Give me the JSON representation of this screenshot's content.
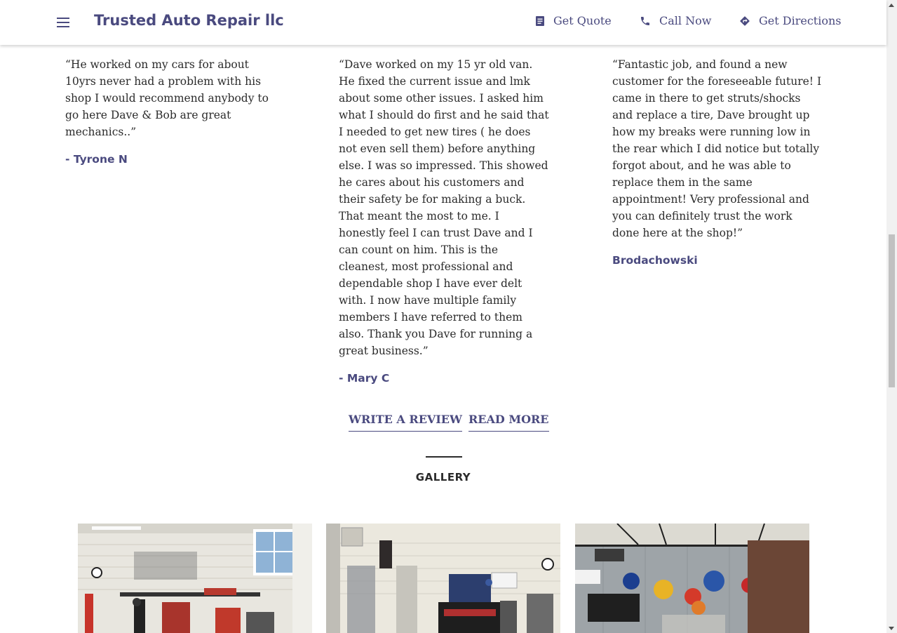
{
  "header": {
    "brand": "Trusted Auto Repair llc",
    "actions": [
      {
        "label": "Get Quote",
        "icon": "document-icon"
      },
      {
        "label": "Call Now",
        "icon": "phone-icon"
      },
      {
        "label": "Get Directions",
        "icon": "directions-icon"
      }
    ]
  },
  "reviews": [
    {
      "text": "“He worked on my cars for about 10yrs never had a problem with his shop I would recommend anybody to go here Dave & Bob are great mechanics..”",
      "author": "- Tyrone N"
    },
    {
      "text": "“Dave worked on my 15 yr old van. He fixed the current issue and lmk about some other issues. I asked him what I should do first and he said that I needed to get new tires ( he does not even sell them) before anything else. I was so impressed. This showed he cares about his customers and their safety be for making a buck. That meant the most to me. I honestly feel I can trust Dave and I can count on him. This is the cleanest, most professional and dependable shop I have ever delt with. I now have multiple family members I have referred to them also. Thank you Dave for running a great business.”",
      "author": "- Mary C"
    },
    {
      "text": "“Fantastic job, and found a new customer for the foreseeable future! I came in there to get struts/shocks and replace a tire, Dave brought up how my breaks were running low in the rear which I did notice but totally forgot about, and he was able to replace them in the same appointment! Very professional and you can definitely trust the work done here at the shop!”",
      "author": "Brodachowski"
    }
  ],
  "review_links": {
    "write": "WRITE A REVIEW",
    "read": "READ MORE"
  },
  "gallery": {
    "title": "GALLERY",
    "photos": [
      {
        "name": "shop-bay-photo-1"
      },
      {
        "name": "shop-bay-photo-2"
      },
      {
        "name": "shop-lobby-photo"
      }
    ]
  },
  "colors": {
    "brand": "#4a4a7f",
    "text": "#2b2b2b"
  }
}
